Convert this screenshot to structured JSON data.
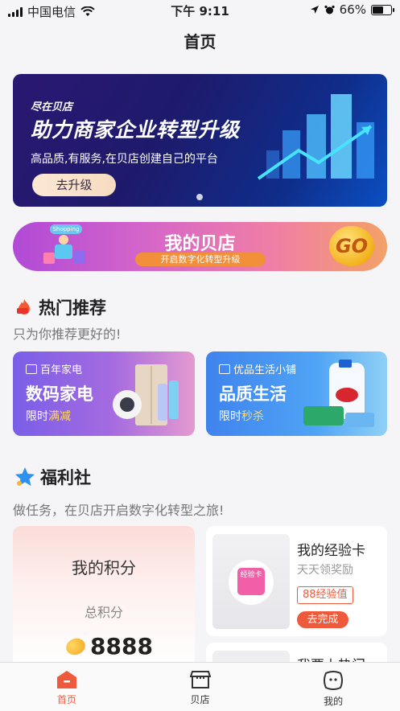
{
  "status_bar": {
    "carrier": "中国电信",
    "time": "下午 9:11",
    "battery": "66%",
    "battery_level": 0.66
  },
  "nav": {
    "title": "首页"
  },
  "banner": {
    "tag": "尽在贝店",
    "headline": "助力商家企业转型升级",
    "subline": "高品质,有服务,在贝店创建自己的平台",
    "button": "去升级",
    "page_index": 1,
    "page_count": 1
  },
  "promo": {
    "badge": "Shopping",
    "title": "我的贝店",
    "subtitle": "开启数字化转型升级",
    "go": "GO"
  },
  "hot": {
    "title": "热门推荐",
    "subtitle": "只为你推荐更好的!",
    "cards": [
      {
        "kicker": "百年家电",
        "title": "数码家电",
        "sub_prefix": "限时",
        "sub_highlight": "满减"
      },
      {
        "kicker": "优品生活小铺",
        "title": "品质生活",
        "sub_prefix": "限时",
        "sub_highlight": "秒杀"
      }
    ]
  },
  "welfare": {
    "title": "福利社",
    "subtitle": "做任务，在贝店开启数字化转型之旅!",
    "points": {
      "title": "我的积分",
      "label": "总积分",
      "value": "8888"
    },
    "task": {
      "badge": "经验卡",
      "name": "我的经验卡",
      "desc": "天天领奖励",
      "xp": "88经验值",
      "button": "去完成"
    },
    "task2": {
      "name": "我要上热门"
    }
  },
  "tabbar": {
    "items": [
      {
        "label": "首页",
        "icon": "home-icon",
        "active": true
      },
      {
        "label": "贝店",
        "icon": "shop-icon",
        "active": false
      },
      {
        "label": "我的",
        "icon": "profile-icon",
        "active": false
      }
    ]
  },
  "colors": {
    "accent": "#f05a3c",
    "banner_bg": "#1e1a6b",
    "card_purple": "#7a5ee8",
    "card_blue": "#3f83ee"
  }
}
